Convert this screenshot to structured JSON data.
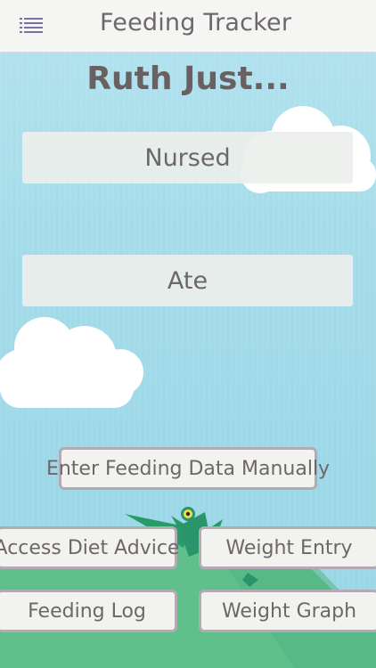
{
  "header": {
    "title": "Feeding Tracker",
    "menu_icon": "list-menu-icon"
  },
  "heading": "Ruth Just...",
  "actions": {
    "nursed_label": "Nursed",
    "ate_label": "Ate"
  },
  "buttons": {
    "manual_label": "Enter Feeding Data Manually",
    "diet_label": "Access Diet Advice",
    "weight_entry_label": "Weight Entry",
    "feeding_log_label": "Feeding Log",
    "weight_graph_label": "Weight Graph"
  },
  "colors": {
    "sky": "#a4dbe9",
    "hill": "#5fc08c",
    "accent": "#7b6fa6",
    "text": "#6d666a"
  }
}
